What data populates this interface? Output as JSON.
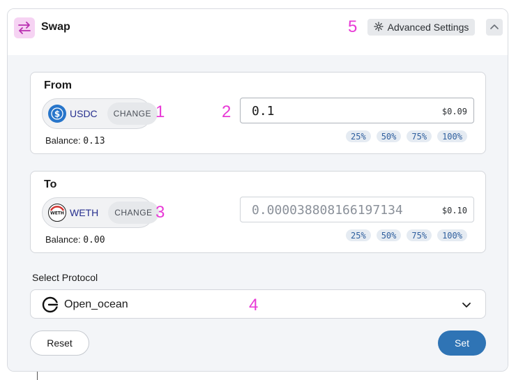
{
  "header": {
    "title": "Swap",
    "advanced_settings_label": "Advanced Settings"
  },
  "annotations": {
    "a1": "1",
    "a2": "2",
    "a3": "3",
    "a4": "4",
    "a5": "5"
  },
  "from": {
    "label": "From",
    "token": "USDC",
    "change_label": "CHANGE",
    "balance_label": "Balance:",
    "balance_value": "0.13",
    "amount": "0.1",
    "usd_value": "$0.09",
    "percent_options": [
      "25%",
      "50%",
      "75%",
      "100%"
    ]
  },
  "to": {
    "label": "To",
    "token": "WETH",
    "change_label": "CHANGE",
    "balance_label": "Balance:",
    "balance_value": "0.00",
    "amount": "0.000038808166197134",
    "usd_value": "$0.10",
    "percent_options": [
      "25%",
      "50%",
      "75%",
      "100%"
    ]
  },
  "protocol": {
    "label": "Select Protocol",
    "selected": "Open_ocean"
  },
  "actions": {
    "reset_label": "Reset",
    "set_label": "Set"
  },
  "icons": {
    "swap": "swap-arrows-icon",
    "settings": "gear-icon",
    "collapse": "chevron-up-icon",
    "usdc": "usdc-token-icon",
    "weth": "weth-token-icon",
    "protocol": "open-ocean-icon",
    "dropdown": "chevron-down-icon"
  },
  "colors": {
    "accent": "#2f74b5",
    "annotation": "#e83ad6",
    "token_text": "#27308f"
  }
}
